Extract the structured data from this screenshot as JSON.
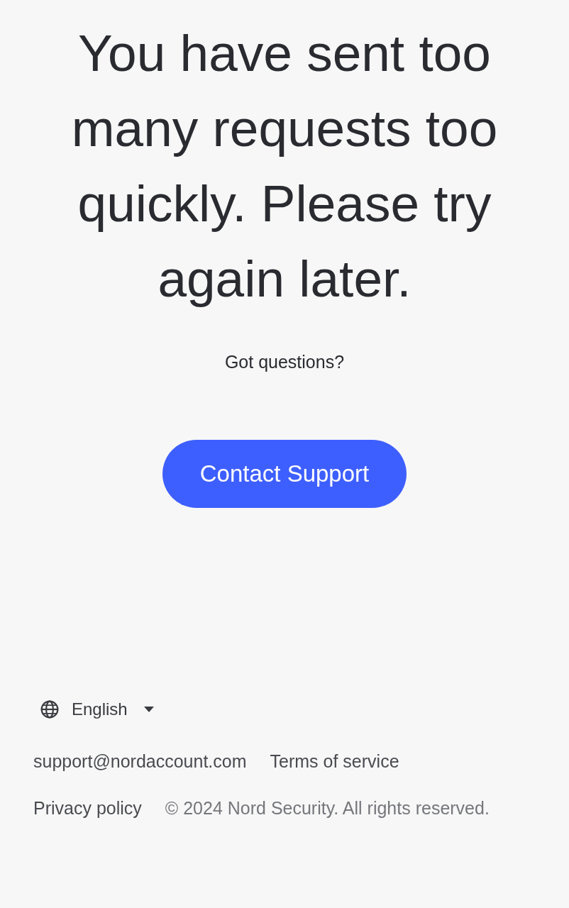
{
  "heading": "You have sent too many requests too quickly. Please try again later.",
  "prompt": "Got questions?",
  "button": {
    "label": "Contact Support"
  },
  "footer": {
    "language": {
      "label": "English"
    },
    "rows": [
      [
        {
          "kind": "link",
          "text": "support@nordaccount.com"
        },
        {
          "kind": "link",
          "text": "Terms of service"
        }
      ],
      [
        {
          "kind": "link",
          "text": "Privacy policy"
        },
        {
          "kind": "notice",
          "text": "© 2024 Nord Security. All rights reserved."
        }
      ]
    ]
  }
}
